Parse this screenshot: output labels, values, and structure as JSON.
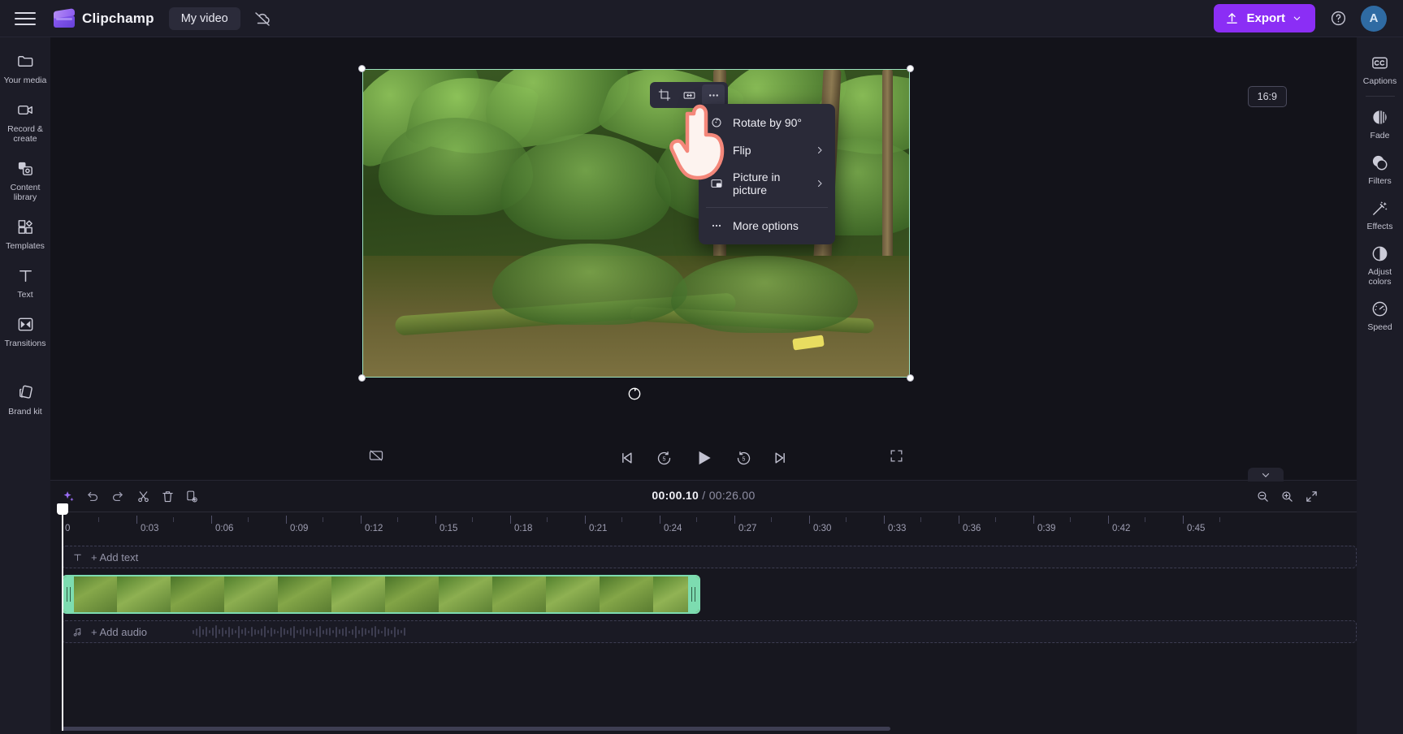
{
  "app": {
    "brand_name": "Clipchamp",
    "project_name": "My video",
    "accent_purple": "#8b2ef5",
    "clip_accent_green": "#7ddcb0",
    "avatar_initial": "A"
  },
  "topbar": {
    "menu_icon": "hamburger-icon",
    "logo_icon": "clipchamp-logo-icon",
    "cloud_icon": "cloud-off-icon",
    "export_label": "Export",
    "export_icon": "upload-icon",
    "export_chevron_icon": "chevron-down-icon",
    "help_icon": "question-circle-icon"
  },
  "left_rail": {
    "items": [
      {
        "label": "Your media",
        "icon": "folder-icon"
      },
      {
        "label": "Record & create",
        "icon": "video-camera-icon"
      },
      {
        "label": "Content library",
        "icon": "content-library-icon"
      },
      {
        "label": "Templates",
        "icon": "templates-grid-icon"
      },
      {
        "label": "Text",
        "icon": "text-t-icon"
      },
      {
        "label": "Transitions",
        "icon": "transitions-icon"
      },
      {
        "label": "Brand kit",
        "icon": "brand-kit-icon"
      }
    ],
    "collapse_icon": "chevron-right-icon"
  },
  "right_rail": {
    "items": [
      {
        "label": "Captions",
        "icon": "closed-caption-icon"
      },
      {
        "label": "Fade",
        "icon": "fade-icon"
      },
      {
        "label": "Filters",
        "icon": "filters-icon"
      },
      {
        "label": "Effects",
        "icon": "magic-wand-icon"
      },
      {
        "label": "Adjust colors",
        "icon": "contrast-icon"
      },
      {
        "label": "Speed",
        "icon": "speedometer-icon"
      }
    ],
    "collapse_icon": "chevron-left-icon"
  },
  "preview": {
    "aspect_ratio": "16:9",
    "float_toolbar": [
      {
        "name": "crop",
        "icon": "crop-icon"
      },
      {
        "name": "fit-width",
        "icon": "fit-width-icon"
      },
      {
        "name": "more",
        "icon": "ellipsis-icon"
      }
    ],
    "rotate_handle_icon": "rotate-icon"
  },
  "context_menu": {
    "items": [
      {
        "label": "Rotate by 90°",
        "icon": "rotate-90-icon",
        "has_submenu": false
      },
      {
        "label": "Flip",
        "icon": "flip-icon",
        "has_submenu": true
      },
      {
        "label": "Picture in picture",
        "icon": "picture-in-picture-icon",
        "has_submenu": true
      },
      {
        "label": "More options",
        "icon": "ellipsis-icon",
        "has_submenu": false
      }
    ],
    "submenu_arrow_icon": "chevron-right-icon"
  },
  "player_controls": {
    "captions_toggle_icon": "captions-off-icon",
    "buttons": [
      {
        "name": "skip-to-start",
        "icon": "skip-start-icon"
      },
      {
        "name": "rewind-5",
        "icon": "rewind-5-icon",
        "seconds": "5"
      },
      {
        "name": "play",
        "icon": "play-icon"
      },
      {
        "name": "forward-5",
        "icon": "forward-5-icon",
        "seconds": "5"
      },
      {
        "name": "skip-to-end",
        "icon": "skip-end-icon"
      }
    ],
    "fullscreen_icon": "fullscreen-icon"
  },
  "timeline": {
    "toolbar": [
      {
        "name": "ai-suggestions",
        "icon": "sparkle-icon"
      },
      {
        "name": "undo",
        "icon": "undo-icon"
      },
      {
        "name": "redo",
        "icon": "redo-icon"
      },
      {
        "name": "split",
        "icon": "scissors-icon"
      },
      {
        "name": "delete",
        "icon": "trash-icon"
      },
      {
        "name": "duplicate",
        "icon": "duplicate-icon"
      }
    ],
    "current_time": "00:00.10",
    "total_time": "00:26.00",
    "time_separator": "/",
    "zoom_controls": [
      {
        "name": "zoom-out",
        "icon": "zoom-out-icon"
      },
      {
        "name": "zoom-in",
        "icon": "zoom-in-icon"
      },
      {
        "name": "fit-to-screen",
        "icon": "fit-screen-icon"
      }
    ],
    "collapse_icon": "chevron-down-icon",
    "ruler_labels": [
      "0",
      "0:03",
      "0:06",
      "0:09",
      "0:12",
      "0:15",
      "0:18",
      "0:21",
      "0:24",
      "0:27",
      "0:30",
      "0:33",
      "0:36",
      "0:39",
      "0:42",
      "0:45"
    ],
    "tracks": [
      {
        "name": "text-track",
        "label": "+ Add text",
        "icon": "text-t-icon",
        "type": "placeholder"
      },
      {
        "name": "video-track",
        "label": "",
        "icon": "",
        "type": "clip"
      },
      {
        "name": "audio-track",
        "label": "+ Add audio",
        "icon": "music-note-icon",
        "type": "placeholder"
      }
    ]
  }
}
